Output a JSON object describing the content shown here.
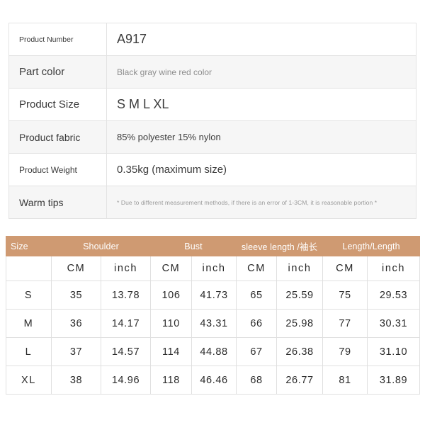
{
  "spec": {
    "rows": [
      {
        "label": "Product Number",
        "value": "A917"
      },
      {
        "label": "Part color",
        "value": "Black gray wine red color"
      },
      {
        "label": "Product Size",
        "value": "S M L XL"
      },
      {
        "label": "Product fabric",
        "value": "85% polyester 15% nylon"
      },
      {
        "label": "Product Weight",
        "value": "0.35kg (maximum size)"
      },
      {
        "label": "Warm tips",
        "value": "* Due to different measurement methods, if there is an error of 1-3CM, it is reasonable portion *"
      }
    ]
  },
  "size_chart": {
    "group_headers": [
      "Size",
      "Shoulder",
      "Bust",
      "sleeve length /袖长",
      "Length/Length"
    ],
    "unit_headers": [
      "",
      "CM",
      "inch",
      "CM",
      "inch",
      "CM",
      "inch",
      "CM",
      "inch"
    ],
    "rows": [
      {
        "size": "S",
        "shoulder_cm": "35",
        "shoulder_in": "13.78",
        "bust_cm": "106",
        "bust_in": "41.73",
        "sleeve_cm": "65",
        "sleeve_in": "25.59",
        "length_cm": "75",
        "length_in": "29.53"
      },
      {
        "size": "M",
        "shoulder_cm": "36",
        "shoulder_in": "14.17",
        "bust_cm": "110",
        "bust_in": "43.31",
        "sleeve_cm": "66",
        "sleeve_in": "25.98",
        "length_cm": "77",
        "length_in": "30.31"
      },
      {
        "size": "L",
        "shoulder_cm": "37",
        "shoulder_in": "14.57",
        "bust_cm": "114",
        "bust_in": "44.88",
        "sleeve_cm": "67",
        "sleeve_in": "26.38",
        "length_cm": "79",
        "length_in": "31.10"
      },
      {
        "size": "XL",
        "shoulder_cm": "38",
        "shoulder_in": "14.96",
        "bust_cm": "118",
        "bust_in": "46.46",
        "sleeve_cm": "68",
        "sleeve_in": "26.77",
        "length_cm": "81",
        "length_in": "31.89"
      }
    ]
  },
  "colors": {
    "header_band": "#cf9a72",
    "alt_row": "#f6f6f6",
    "border": "#e0e0e0"
  }
}
